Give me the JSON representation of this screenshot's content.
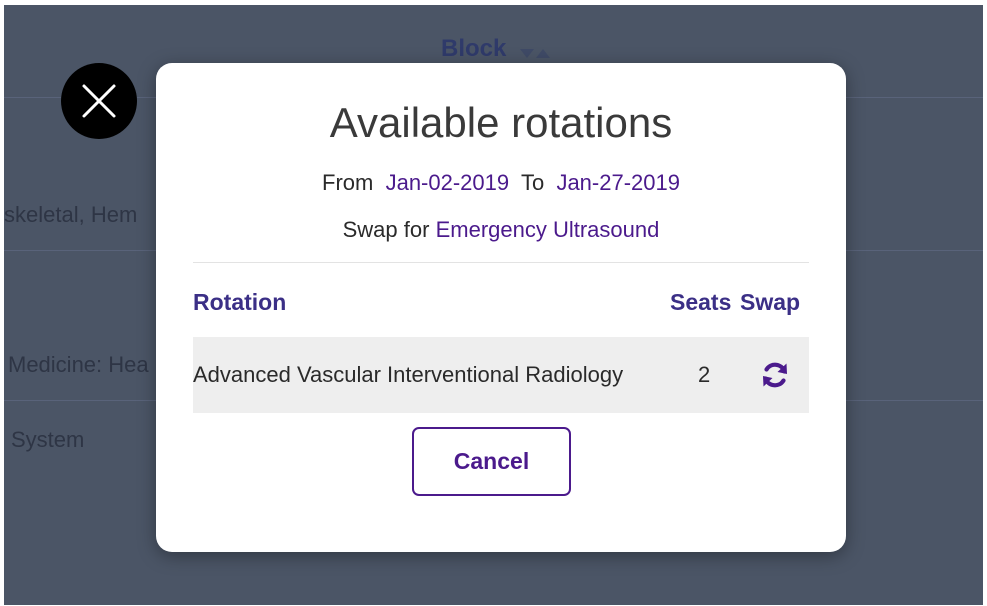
{
  "background": {
    "column_header": "Block",
    "row_texts": [
      "skeletal, Hem",
      "Medicine: Hea",
      "System"
    ]
  },
  "modal": {
    "title": "Available rotations",
    "from_label": "From",
    "from_date": "Jan-02-2019",
    "to_label": "To",
    "to_date": "Jan-27-2019",
    "swap_label": "Swap for",
    "swap_target": "Emergency Ultrasound",
    "table": {
      "headers": {
        "rotation": "Rotation",
        "seats": "Seats",
        "swap": "Swap"
      },
      "rows": [
        {
          "rotation": "Advanced Vascular Interventional Radiology",
          "seats": "2",
          "swap_icon": "refresh-icon"
        }
      ]
    },
    "cancel_label": "Cancel"
  },
  "colors": {
    "accent": "#4b1a8c",
    "header_text": "#3b2f86",
    "overlay": "#4b5566"
  },
  "icons": {
    "close": "close-icon",
    "sort": "sort-arrows-icon",
    "swap": "refresh-icon"
  }
}
